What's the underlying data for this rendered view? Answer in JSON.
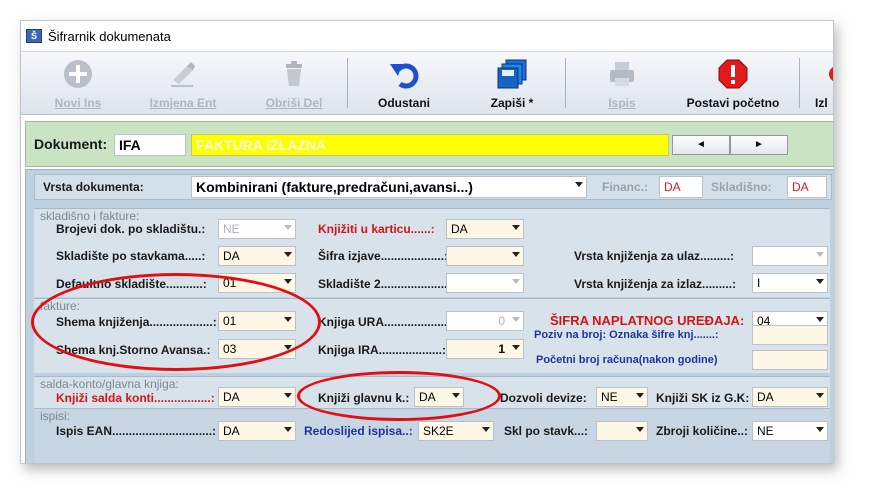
{
  "window": {
    "title": "Šifrarnik dokumenata"
  },
  "toolbar": {
    "novi": "Novi Ins",
    "izmjena": "Izmjena Ent",
    "obrisi": "Obriši Del",
    "odustani": "Odustani",
    "zapisi": "Zapiši *",
    "ispis": "Ispis",
    "postavi": "Postavi početno",
    "izlaz": "Izl"
  },
  "document": {
    "label": "Dokument:",
    "code": "IFA",
    "name": "FAKTURA IZLAZNA",
    "prev": "◄",
    "next": "►"
  },
  "vrsta": {
    "label": "Vrsta dokumenta:",
    "value": "Kombinirani (fakture,predračuni,avansi...)",
    "financ_label": "Financ.:",
    "financ_value": "DA",
    "skladisno_label": "Skladišno:",
    "skladisno_value": "DA"
  },
  "skladisno": {
    "section": "skladišno i fakture:",
    "brojevi_label": "Brojevi dok. po skladištu.:",
    "brojevi_value": "NE",
    "knjiziti_label": "Knjižiti u karticu......:",
    "knjiziti_value": "DA",
    "stavke_label": "Skladište po stavkama.....:",
    "stavke_value": "DA",
    "izjava_label": "Šifra izjave...................:",
    "izjava_value": "",
    "ulaz_label": "Vrsta knjiženja za ulaz.........:",
    "ulaz_value": "",
    "default_label": "Defaultno skladište...........:",
    "default_value": "01",
    "skl2_label": "Skladište 2....................:",
    "skl2_value": "",
    "izlaz_label": "Vrsta knjiženja za izlaz.........:",
    "izlaz_value": "I"
  },
  "fakture": {
    "section": "fakture:",
    "shema_label": "Shema knjiženja...................:",
    "shema_value": "01",
    "ura_label": "Knjiga URA...................:",
    "ura_value": "0",
    "sifra_nap_label": "ŠIFRA NAPLATNOG UREĐAJA:",
    "sifra_nap_value": "04",
    "storno_label": "Shema knj.Storno Avansa.:",
    "storno_value": "03",
    "ira_label": "Knjiga IRA...................:",
    "ira_value": "1",
    "poziv_label": "Poziv na broj: Oznaka šifre knj.......:",
    "poziv_value": "",
    "pocetni_label": "Početni broj računa(nakon godine)",
    "pocetni_value": ""
  },
  "salda": {
    "section": "salda-konto/glavna knjiga:",
    "konti_label": "Knjiži salda konti.................:",
    "konti_value": "DA",
    "glavna_label": "Knjiži glavnu k.:",
    "glavna_value": "DA",
    "devize_label": "Dozvoli devize:",
    "devize_value": "NE",
    "sk_label": "Knjiži SK iz G.K:",
    "sk_value": "DA"
  },
  "ispisi": {
    "section": "ispisi:",
    "ean_label": "Ispis EAN..............................:",
    "ean_value": "DA",
    "redoslijed_label": "Redoslijed ispisa..:",
    "redoslijed_value": "SK2E",
    "skl_label": "Skl po stavk...:",
    "skl_value": "",
    "zbroji_label": "Zbroji količine..:",
    "zbroji_value": "NE"
  }
}
